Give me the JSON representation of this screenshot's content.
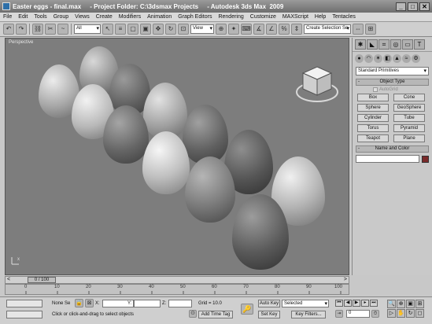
{
  "window": {
    "title": "Easter eggs - final.max     - Project Folder: C:\\3dsmax Projects     - Autodesk 3ds Max  2009",
    "buttons": [
      "_",
      "□",
      "✕"
    ]
  },
  "menu": [
    "File",
    "Edit",
    "Tools",
    "Group",
    "Views",
    "Create",
    "Modifiers",
    "Animation",
    "Graph Editors",
    "Rendering",
    "Customize",
    "MAXScript",
    "Help",
    "Tentacles"
  ],
  "toolbar": {
    "filter_dropdown": "All",
    "reference_coord": "View",
    "selection_set_placeholder": "Create Selection Se"
  },
  "viewport": {
    "label": "Perspective",
    "axis_label": "x",
    "background": "#7d7d7d"
  },
  "command_panel": {
    "category_dropdown": "Standard Primitives",
    "object_type_header": "Object Type",
    "autogrid_label": "AutoGrid",
    "object_buttons": [
      "Box",
      "Cone",
      "Sphere",
      "GeoSphere",
      "Cylinder",
      "Tube",
      "Torus",
      "Pyramid",
      "Teapot",
      "Plane"
    ],
    "name_color_header": "Name and Color",
    "object_color": "#7a2a2a"
  },
  "timeline": {
    "frame_display": "0 / 100",
    "ticks": [
      "0",
      "10",
      "20",
      "30",
      "40",
      "50",
      "60",
      "70",
      "80",
      "90",
      "100"
    ]
  },
  "status": {
    "selection": "None Se",
    "x_label": "X:",
    "y_label": "Y:",
    "z_label": "Z:",
    "grid": "Grid = 10.0",
    "prompt": "Click or click-and-drag to select objects",
    "add_time_tag": "Add Time Tag",
    "auto_key": "Auto Key",
    "set_key": "Set Key",
    "key_filter_value": "Selected",
    "key_filters": "Key Filters...",
    "frame_value": "0"
  }
}
